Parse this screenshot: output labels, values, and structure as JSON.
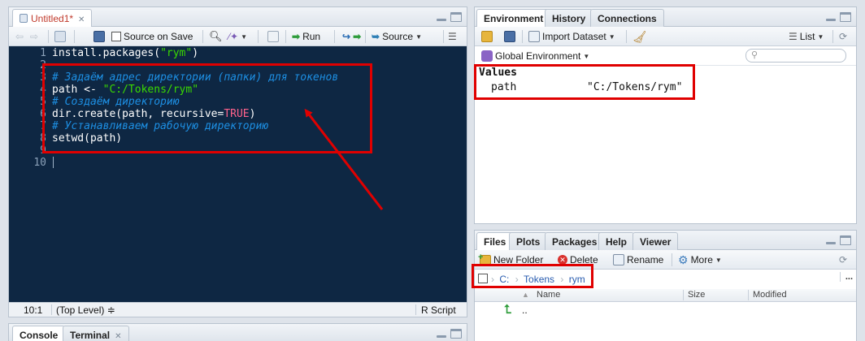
{
  "source_pane": {
    "tab_label": "Untitled1*",
    "toolbar": {
      "source_on_save_label": "Source on Save",
      "run_label": "Run",
      "source_label": "Source"
    },
    "lines": [
      {
        "num": "1",
        "parts": [
          {
            "t": "install.packages(",
            "c": "plain"
          },
          {
            "t": "\"rym\"",
            "c": "str"
          },
          {
            "t": ")",
            "c": "plain"
          }
        ]
      },
      {
        "num": "2",
        "parts": []
      },
      {
        "num": "3",
        "parts": [
          {
            "t": "# Задаём адрес директории (папки) для токенов",
            "c": "cmt"
          }
        ]
      },
      {
        "num": "4",
        "parts": [
          {
            "t": "path <- ",
            "c": "plain"
          },
          {
            "t": "\"C:/Tokens/rym\"",
            "c": "str"
          }
        ]
      },
      {
        "num": "5",
        "parts": [
          {
            "t": "# Создаём директорию",
            "c": "cmt"
          }
        ]
      },
      {
        "num": "6",
        "parts": [
          {
            "t": "dir.create(path, recursive=",
            "c": "plain"
          },
          {
            "t": "TRUE",
            "c": "kw"
          },
          {
            "t": ")",
            "c": "plain"
          }
        ]
      },
      {
        "num": "7",
        "parts": [
          {
            "t": "# Устанавливаем рабочую директорию",
            "c": "cmt"
          }
        ]
      },
      {
        "num": "8",
        "parts": [
          {
            "t": "setwd(path)",
            "c": "plain"
          }
        ]
      },
      {
        "num": "9",
        "parts": []
      },
      {
        "num": "10",
        "parts": []
      }
    ],
    "status": {
      "position": "10:1",
      "scope": "(Top Level) ≑",
      "filetype": "R Script ≑"
    }
  },
  "console_pane": {
    "tabs": [
      "Console",
      "Terminal"
    ]
  },
  "env_pane": {
    "tabs": [
      "Environment",
      "History",
      "Connections"
    ],
    "toolbar": {
      "import_label": "Import Dataset",
      "list_label": "List"
    },
    "env_selector": "Global Environment",
    "section_header": "Values",
    "rows": [
      {
        "name": "path",
        "value": "\"C:/Tokens/rym\""
      }
    ]
  },
  "files_pane": {
    "tabs": [
      "Files",
      "Plots",
      "Packages",
      "Help",
      "Viewer"
    ],
    "toolbar": {
      "new_folder_label": "New Folder",
      "delete_label": "Delete",
      "rename_label": "Rename",
      "more_label": "More"
    },
    "breadcrumb": [
      "C:",
      "Tokens",
      "rym"
    ],
    "more_dots": "...",
    "columns": {
      "name": "Name",
      "size": "Size",
      "modified": "Modified"
    },
    "rows": [
      {
        "name": ".."
      }
    ]
  },
  "colors": {
    "editor_bg": "#0e2743",
    "string": "#3ad900",
    "comment": "#1d8fe3",
    "keyword": "#ff628c",
    "annotation_red": "#e00000"
  }
}
